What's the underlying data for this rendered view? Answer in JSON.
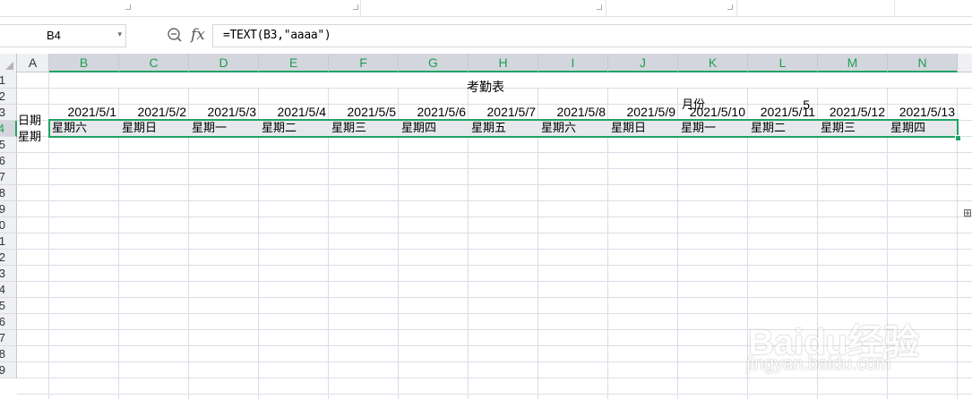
{
  "formula_bar": {
    "cell_ref": "B4",
    "fx_label": "fx",
    "formula": "=TEXT(B3,\"aaaa\")"
  },
  "columns": [
    "A",
    "B",
    "C",
    "D",
    "E",
    "F",
    "G",
    "H",
    "I",
    "J",
    "K",
    "L",
    "M",
    "N"
  ],
  "rows": [
    "1",
    "2",
    "3",
    "4",
    "5",
    "6",
    "7",
    "8",
    "9",
    "0",
    "1",
    "2",
    "3",
    "4",
    "5",
    "6",
    "7",
    "8",
    "9"
  ],
  "sheet": {
    "title": "考勤表",
    "month_label": "月份",
    "month_value": "5",
    "row3_label": "日期",
    "row4_label": "星期",
    "dates": [
      "2021/5/1",
      "2021/5/2",
      "2021/5/3",
      "2021/5/4",
      "2021/5/5",
      "2021/5/6",
      "2021/5/7",
      "2021/5/8",
      "2021/5/9",
      "2021/5/10",
      "2021/5/11",
      "2021/5/12",
      "2021/5/13"
    ],
    "weekdays": [
      "星期六",
      "星期日",
      "星期一",
      "星期二",
      "星期三",
      "星期四",
      "星期五",
      "星期六",
      "星期日",
      "星期一",
      "星期二",
      "星期三",
      "星期四"
    ]
  },
  "watermark": {
    "logo": "Baidu经验",
    "url": "jingyan.baidu.com"
  },
  "colors": {
    "selection": "#21a366",
    "header_bg": "#eef0f3",
    "gridline": "#d9dde6"
  }
}
